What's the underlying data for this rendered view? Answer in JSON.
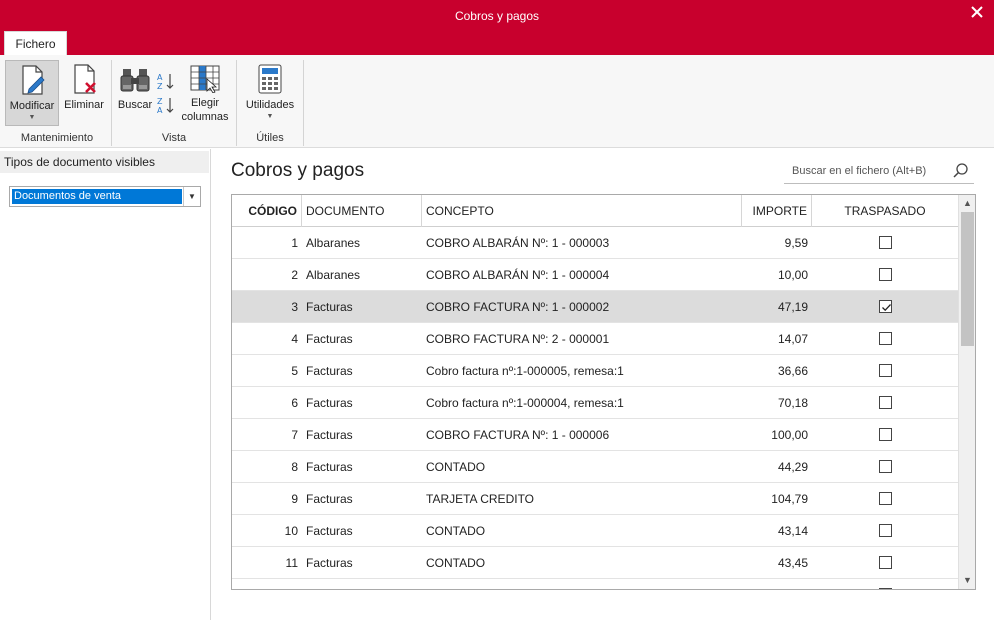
{
  "window": {
    "title": "Cobros y pagos"
  },
  "ribbon": {
    "tab": "Fichero",
    "buttons": {
      "modificar": "Modificar",
      "eliminar": "Eliminar",
      "buscar": "Buscar",
      "elegir": "Elegir",
      "columnas": "columnas",
      "utilidades": "Utilidades"
    },
    "groups": {
      "mantenimiento": "Mantenimiento",
      "vista": "Vista",
      "utiles": "Útiles"
    }
  },
  "sidebar": {
    "header": "Tipos de documento visibles",
    "selected": "Documentos de venta"
  },
  "main": {
    "title": "Cobros y pagos",
    "search_placeholder": "Buscar en el fichero (Alt+B)"
  },
  "table": {
    "columns": [
      "CÓDIGO",
      "DOCUMENTO",
      "CONCEPTO",
      "IMPORTE",
      "TRASPASADO"
    ],
    "rows": [
      {
        "codigo": "1",
        "documento": "Albaranes",
        "concepto": "COBRO ALBARÁN Nº: 1 - 000003",
        "importe": "9,59",
        "traspasado": false
      },
      {
        "codigo": "2",
        "documento": "Albaranes",
        "concepto": "COBRO ALBARÁN Nº: 1 - 000004",
        "importe": "10,00",
        "traspasado": false
      },
      {
        "codigo": "3",
        "documento": "Facturas",
        "concepto": "COBRO FACTURA Nº: 1 - 000002",
        "importe": "47,19",
        "traspasado": true
      },
      {
        "codigo": "4",
        "documento": "Facturas",
        "concepto": "COBRO FACTURA Nº: 2 - 000001",
        "importe": "14,07",
        "traspasado": false
      },
      {
        "codigo": "5",
        "documento": "Facturas",
        "concepto": "Cobro factura nº:1-000005, remesa:1",
        "importe": "36,66",
        "traspasado": false
      },
      {
        "codigo": "6",
        "documento": "Facturas",
        "concepto": "Cobro factura nº:1-000004, remesa:1",
        "importe": "70,18",
        "traspasado": false
      },
      {
        "codigo": "7",
        "documento": "Facturas",
        "concepto": "COBRO FACTURA Nº: 1 - 000006",
        "importe": "100,00",
        "traspasado": false
      },
      {
        "codigo": "8",
        "documento": "Facturas",
        "concepto": "CONTADO",
        "importe": "44,29",
        "traspasado": false
      },
      {
        "codigo": "9",
        "documento": "Facturas",
        "concepto": "TARJETA CREDITO",
        "importe": "104,79",
        "traspasado": false
      },
      {
        "codigo": "10",
        "documento": "Facturas",
        "concepto": "CONTADO",
        "importe": "43,14",
        "traspasado": false
      },
      {
        "codigo": "11",
        "documento": "Facturas",
        "concepto": "CONTADO",
        "importe": "43,45",
        "traspasado": false
      }
    ],
    "selected_index": 2
  },
  "colors": {
    "accent": "#c8002d",
    "selection": "#0078d7"
  }
}
